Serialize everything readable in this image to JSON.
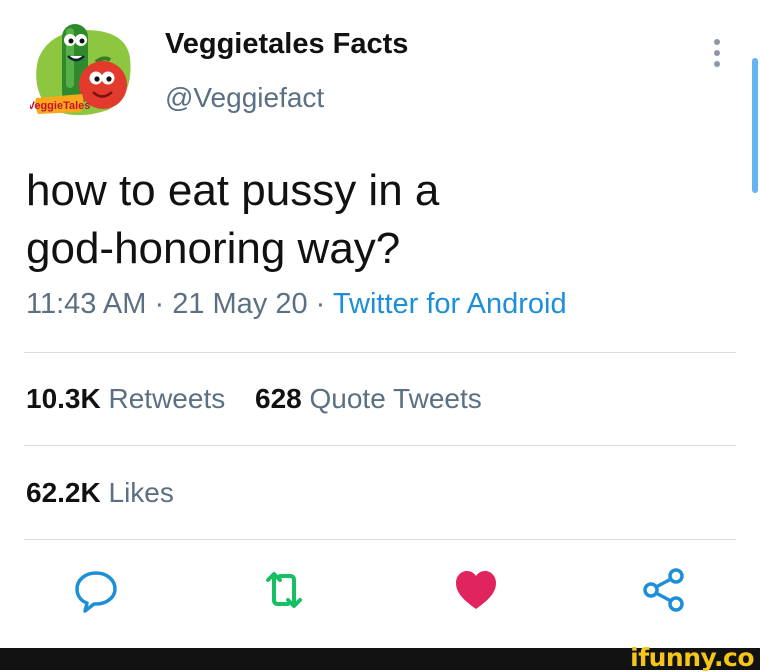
{
  "author": {
    "display_name": "Veggietales Facts",
    "handle": "@Veggiefact",
    "avatar_logo_text": "VeggieTales"
  },
  "tweet": {
    "text_line1": "how to eat pussy in a",
    "text_line2": "god-honoring way?",
    "time": "11:43 AM",
    "separator": "·",
    "date": "21 May 20",
    "source": "Twitter for Android"
  },
  "stats": {
    "retweets_count": "10.3K",
    "retweets_label": "Retweets",
    "quotes_count": "628",
    "quotes_label": "Quote Tweets",
    "likes_count": "62.2K",
    "likes_label": "Likes"
  },
  "actions": [
    "reply-icon",
    "retweet-icon",
    "like-icon",
    "share-icon"
  ],
  "colors": {
    "secondary_text": "#5b7083",
    "link": "#1d8fd8",
    "retweet_green": "#17bf63",
    "like_red": "#e0245e",
    "divider": "#dadde1"
  },
  "watermark": "ifunny.co"
}
